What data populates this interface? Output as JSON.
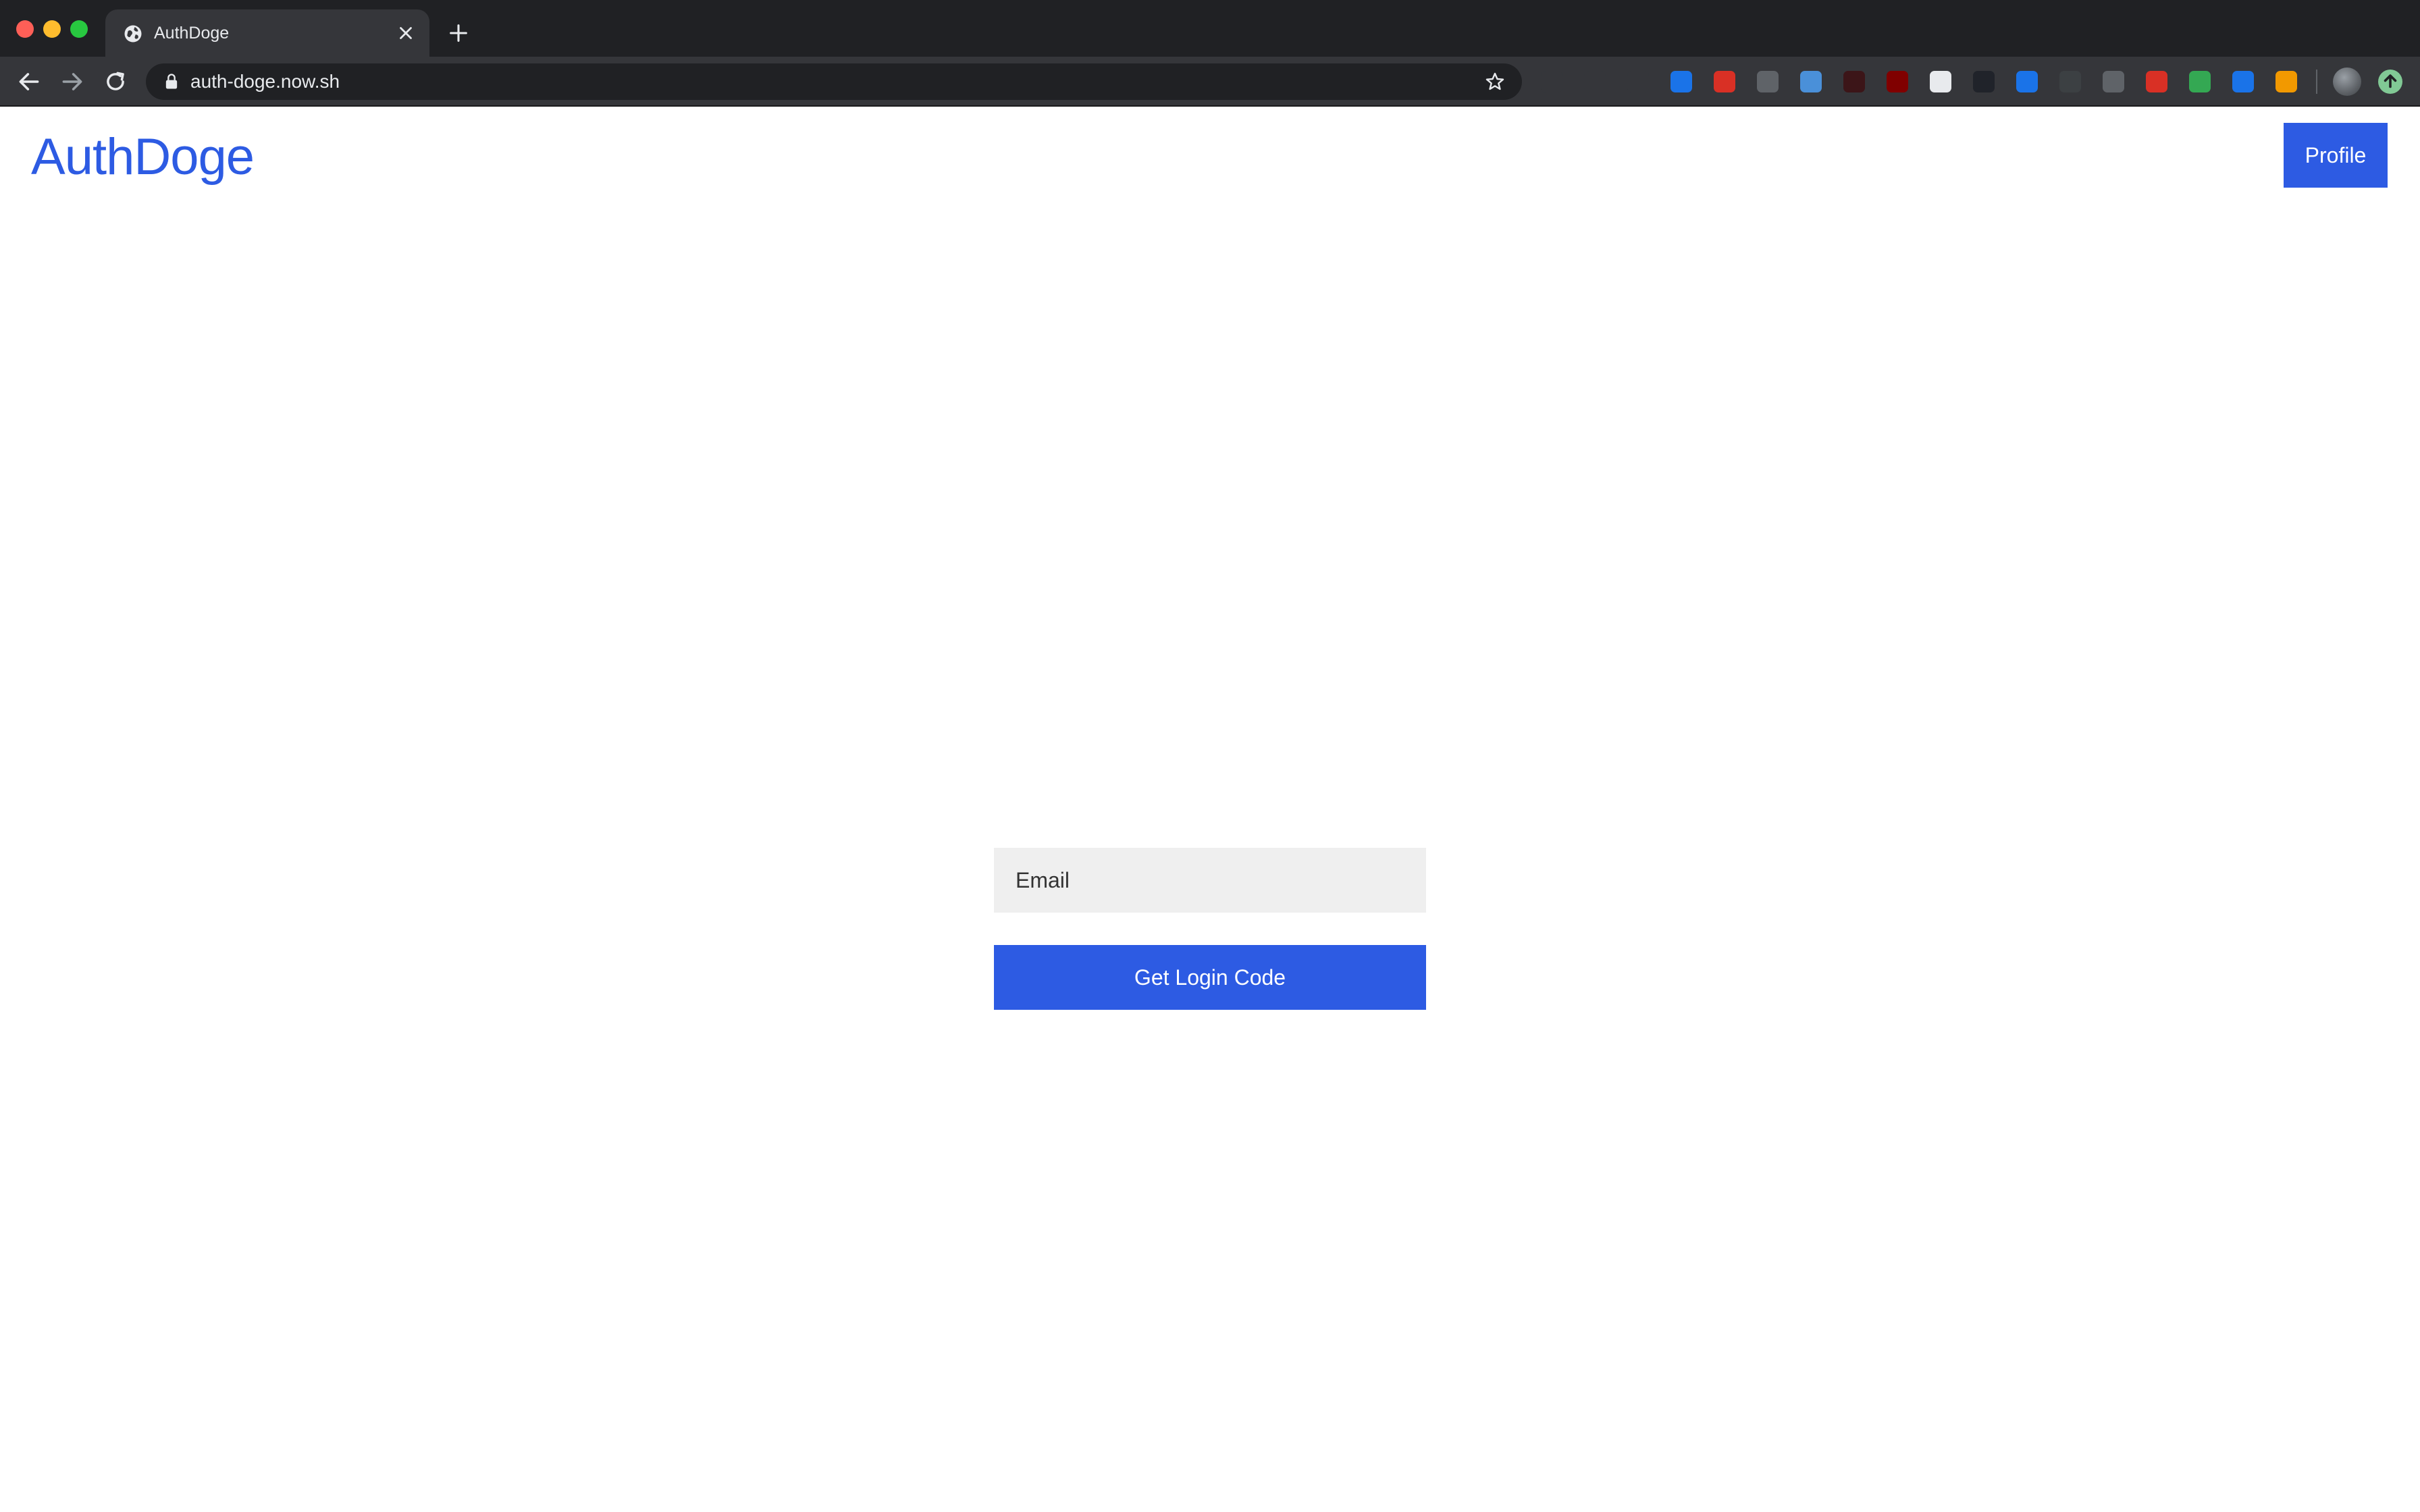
{
  "browser": {
    "tab": {
      "title": "AuthDoge",
      "favicon": "globe-icon"
    },
    "new_tab_icon": "plus-icon",
    "address_bar": {
      "url": "auth-doge.now.sh",
      "secure_icon": "lock-icon",
      "bookmark_icon": "star-icon"
    },
    "nav": {
      "back_icon": "arrow-left-icon",
      "forward_icon": "arrow-right-icon",
      "reload_icon": "reload-icon"
    },
    "extensions": [
      {
        "name": "chat-bubble-icon",
        "color": "#35363a"
      },
      {
        "name": "cursor-icon",
        "color": "#35363a"
      },
      {
        "name": "glasses-icon",
        "color": "#35363a"
      },
      {
        "name": "cap-icon",
        "color": "#1a73e8"
      },
      {
        "name": "video-icon",
        "color": "#d93025"
      },
      {
        "name": "window-icon",
        "color": "#5f6368"
      },
      {
        "name": "v-icon",
        "color": "#4a90d9"
      },
      {
        "name": "h-icon",
        "color": "#3c1518"
      },
      {
        "name": "ublock-icon",
        "color": "#800000"
      },
      {
        "name": "circle-icon",
        "color": "#e8eaed"
      },
      {
        "name": "react-icon",
        "color": "#20232a"
      },
      {
        "name": "onepassword-icon",
        "color": "#1a73e8"
      },
      {
        "name": "ghost-icon",
        "color": "#3c4043"
      },
      {
        "name": "gear-icon",
        "color": "#5f6368"
      },
      {
        "name": "shield-icon",
        "color": "#d93025"
      },
      {
        "name": "mail-icon",
        "color": "#34a853"
      },
      {
        "name": "translate-icon",
        "color": "#1a73e8"
      },
      {
        "name": "box-icon",
        "color": "#f29900"
      }
    ],
    "profile_avatar": "avatar-icon",
    "update_icon": "update-arrow-icon"
  },
  "header": {
    "logo": "AuthDoge",
    "profile_label": "Profile"
  },
  "login_form": {
    "email_placeholder": "Email",
    "email_value": "",
    "submit_label": "Get Login Code"
  },
  "colors": {
    "brand": "#2d5be3",
    "input_bg": "#efefef"
  }
}
